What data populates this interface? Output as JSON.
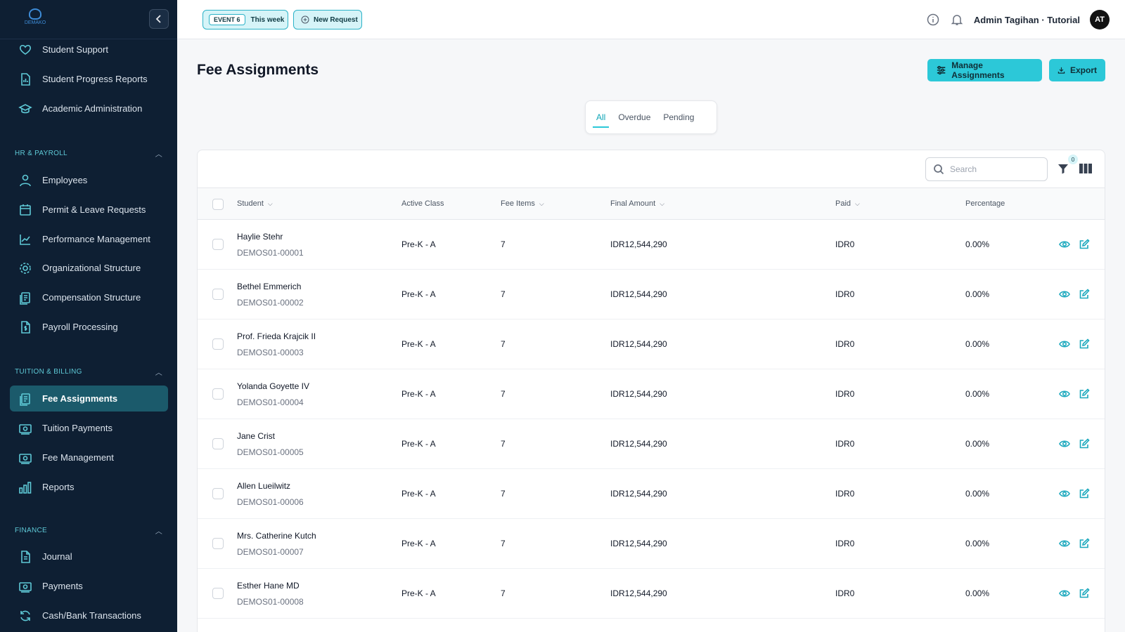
{
  "sidebar": {
    "logo_text": "DEMAKO",
    "items": [
      {
        "label": "Student Support",
        "icon": "heart-icon"
      },
      {
        "label": "Student Progress Reports",
        "icon": "report-icon"
      },
      {
        "label": "Academic Administration",
        "icon": "graduation-cap-icon"
      }
    ],
    "sections": [
      {
        "label": "HR & PAYROLL",
        "items": [
          {
            "label": "Employees",
            "icon": "user-icon"
          },
          {
            "label": "Permit & Leave Requests",
            "icon": "calendar-icon"
          },
          {
            "label": "Performance Management",
            "icon": "chart-line-icon"
          },
          {
            "label": "Organizational Structure",
            "icon": "gear-icon"
          },
          {
            "label": "Compensation Structure",
            "icon": "document-stack-icon"
          },
          {
            "label": "Payroll Processing",
            "icon": "invoice-dollar-icon"
          }
        ]
      },
      {
        "label": "TUITION & BILLING",
        "items": [
          {
            "label": "Fee Assignments",
            "icon": "document-stack-icon",
            "active": true
          },
          {
            "label": "Tuition Payments",
            "icon": "money-icon"
          },
          {
            "label": "Fee Management",
            "icon": "money-icon"
          },
          {
            "label": "Reports",
            "icon": "bar-chart-icon"
          }
        ]
      },
      {
        "label": "FINANCE",
        "items": [
          {
            "label": "Journal",
            "icon": "document-icon"
          },
          {
            "label": "Payments",
            "icon": "money-icon"
          },
          {
            "label": "Cash/Bank Transactions",
            "icon": "refresh-icon"
          }
        ]
      }
    ]
  },
  "topbar": {
    "event_tag": "EVENT 6",
    "event_period": "This week",
    "new_request": "New Request",
    "user_name": "Admin Tagihan · Tutorial",
    "avatar_initials": "AT"
  },
  "page": {
    "title": "Fee Assignments",
    "manage_button": "Manage Assignments",
    "export_button": "Export",
    "tabs": [
      "All",
      "Overdue",
      "Pending"
    ],
    "active_tab": "All",
    "search_placeholder": "Search",
    "filter_count": "0"
  },
  "table": {
    "columns": [
      "Student",
      "Active Class",
      "Fee Items",
      "Final Amount",
      "Paid",
      "Percentage"
    ],
    "rows": [
      {
        "name": "Haylie Stehr",
        "code": "DEMOS01-00001",
        "class": "Pre-K - A",
        "fee_items": "7",
        "final_amount": "IDR12,544,290",
        "paid": "IDR0",
        "percentage": "0.00%"
      },
      {
        "name": "Bethel Emmerich",
        "code": "DEMOS01-00002",
        "class": "Pre-K - A",
        "fee_items": "7",
        "final_amount": "IDR12,544,290",
        "paid": "IDR0",
        "percentage": "0.00%"
      },
      {
        "name": "Prof. Frieda Krajcik II",
        "code": "DEMOS01-00003",
        "class": "Pre-K - A",
        "fee_items": "7",
        "final_amount": "IDR12,544,290",
        "paid": "IDR0",
        "percentage": "0.00%"
      },
      {
        "name": "Yolanda Goyette IV",
        "code": "DEMOS01-00004",
        "class": "Pre-K - A",
        "fee_items": "7",
        "final_amount": "IDR12,544,290",
        "paid": "IDR0",
        "percentage": "0.00%"
      },
      {
        "name": "Jane Crist",
        "code": "DEMOS01-00005",
        "class": "Pre-K - A",
        "fee_items": "7",
        "final_amount": "IDR12,544,290",
        "paid": "IDR0",
        "percentage": "0.00%"
      },
      {
        "name": "Allen Lueilwitz",
        "code": "DEMOS01-00006",
        "class": "Pre-K - A",
        "fee_items": "7",
        "final_amount": "IDR12,544,290",
        "paid": "IDR0",
        "percentage": "0.00%"
      },
      {
        "name": "Mrs. Catherine Kutch",
        "code": "DEMOS01-00007",
        "class": "Pre-K - A",
        "fee_items": "7",
        "final_amount": "IDR12,544,290",
        "paid": "IDR0",
        "percentage": "0.00%"
      },
      {
        "name": "Esther Hane MD",
        "code": "DEMOS01-00008",
        "class": "Pre-K - A",
        "fee_items": "7",
        "final_amount": "IDR12,544,290",
        "paid": "IDR0",
        "percentage": "0.00%"
      }
    ]
  }
}
